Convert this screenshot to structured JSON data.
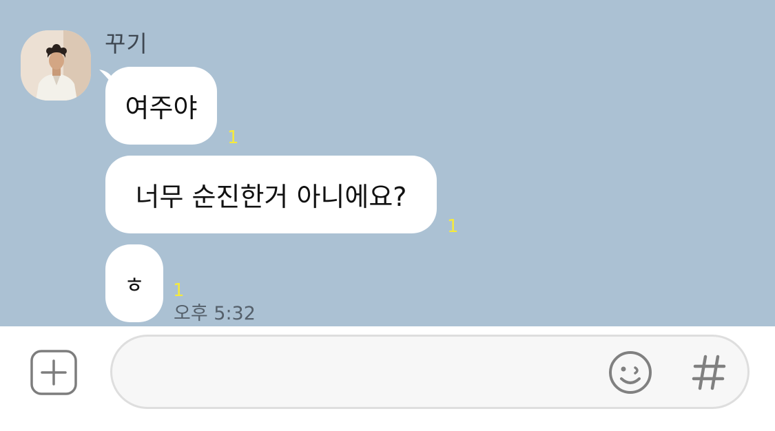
{
  "chat": {
    "background_color": "#abc1d3",
    "sender": {
      "name": "꾸기",
      "avatar": "profile-photo"
    },
    "messages": [
      {
        "text": "여주야",
        "unread_count": "1"
      },
      {
        "text": "너무 순진한거 아니에요?",
        "unread_count": "1"
      },
      {
        "text": "ㅎ",
        "unread_count": "1"
      }
    ],
    "last_message_time": "오후 5:32",
    "unread_color": "#f6ea3b"
  },
  "input_bar": {
    "attach_icon": "plus-square-icon",
    "message_value": "",
    "emoji_icon": "smiley-icon",
    "hashtag_icon": "hash-icon"
  }
}
